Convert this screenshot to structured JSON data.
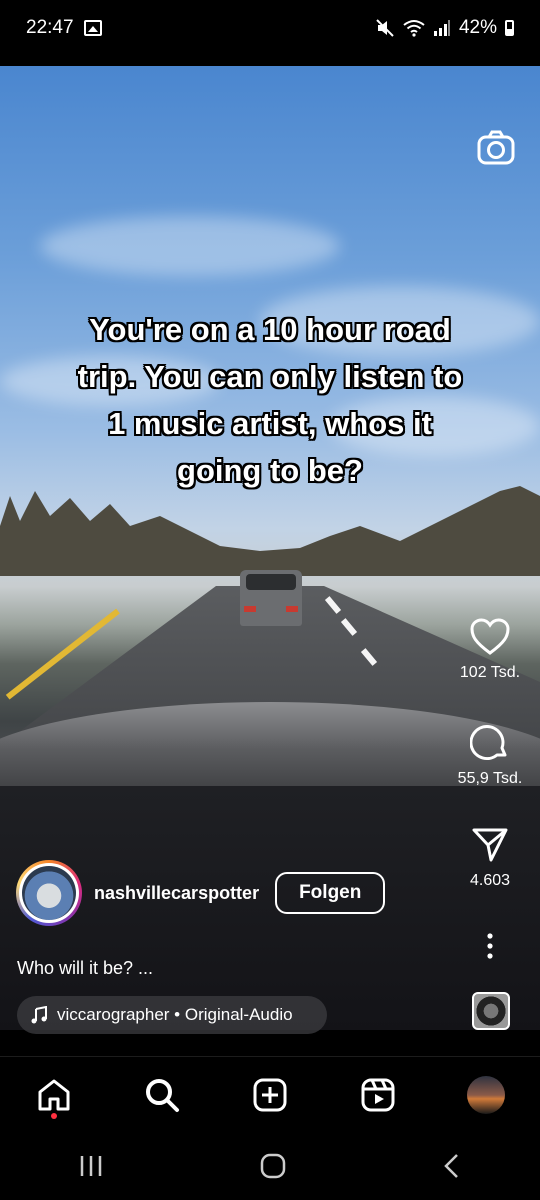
{
  "status": {
    "time": "22:47",
    "battery": "42%"
  },
  "reel": {
    "overlay_text": "You're on a 10 hour road trip. You can only listen to 1 music artist, whos it going to be?",
    "likes": "102 Tsd.",
    "comments": "55,9 Tsd.",
    "shares": "4.603",
    "username": "nashvillecarspotter",
    "follow_label": "Folgen",
    "caption": "Who will it be? ...",
    "audio_label": "viccarographer • Original-Audio"
  },
  "icons": {
    "camera": "camera-icon",
    "like": "heart-icon",
    "comment": "comment-icon",
    "share": "send-icon",
    "more": "more-vertical-icon",
    "music": "music-note-icon"
  },
  "nav": [
    "home-icon",
    "search-icon",
    "create-icon",
    "reels-icon",
    "profile-icon"
  ],
  "colors": {
    "background": "#000000",
    "notification_dot": "#ff3040"
  }
}
